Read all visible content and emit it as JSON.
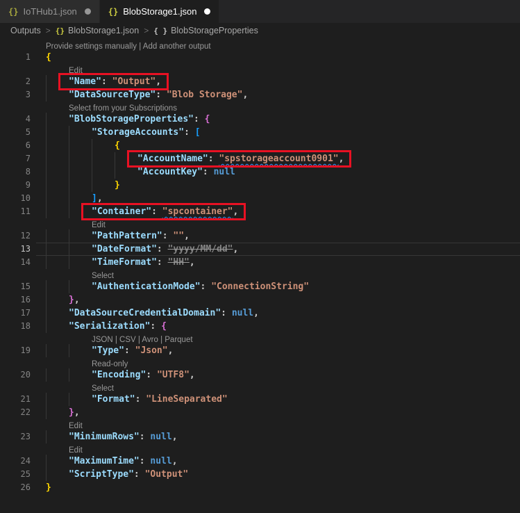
{
  "tabs": [
    {
      "icon": "{}",
      "label": "IoTHub1.json",
      "modified": true,
      "active": false
    },
    {
      "icon": "{}",
      "label": "BlobStorage1.json",
      "modified": true,
      "active": true
    }
  ],
  "breadcrumb": {
    "separator": ">",
    "items": [
      {
        "label": "Outputs"
      },
      {
        "icon": "{}",
        "label": "BlobStorage1.json"
      },
      {
        "icon": "{ }",
        "label": "BlobStorageProperties"
      }
    ]
  },
  "colors": {
    "editor_background": "#1e1e1e",
    "tabbar_background": "#252526",
    "red_highlight_box": "#e81123",
    "info_squiggle": "#3794ff",
    "key": "#9cdcfe",
    "string": "#ce9178",
    "keyword_null": "#569cd6",
    "bracket_level1": "#ffd700",
    "bracket_level2": "#da70d6",
    "bracket_level3": "#179fff"
  },
  "editor": {
    "language": "json",
    "current_line": 13,
    "lines": [
      {
        "num": 1,
        "indent": 0,
        "lens": {
          "text": "Provide settings manually | Add another output",
          "indent": 0
        },
        "tokens": [
          [
            "b1",
            "{"
          ]
        ]
      },
      {
        "num": 2,
        "indent": 1,
        "lens": {
          "text": "Edit",
          "indent": 1
        },
        "redbox": true,
        "tokens": [
          [
            "k",
            "\"Name\""
          ],
          [
            "p",
            ": "
          ],
          [
            "s",
            "\"Output\""
          ],
          [
            "p",
            ","
          ]
        ]
      },
      {
        "num": 3,
        "indent": 1,
        "tokens": [
          [
            "k",
            "\"DataSourceType\""
          ],
          [
            "p",
            ": "
          ],
          [
            "s",
            "\"Blob Storage\""
          ],
          [
            "p",
            ","
          ]
        ]
      },
      {
        "num": 4,
        "indent": 1,
        "lens": {
          "text": "Select from your Subscriptions",
          "indent": 1
        },
        "tokens": [
          [
            "k",
            "\"BlobStorageProperties\""
          ],
          [
            "p",
            ": "
          ],
          [
            "b2",
            "{"
          ]
        ]
      },
      {
        "num": 5,
        "indent": 2,
        "tokens": [
          [
            "k",
            "\"StorageAccounts\""
          ],
          [
            "p",
            ": "
          ],
          [
            "b3",
            "["
          ]
        ]
      },
      {
        "num": 6,
        "indent": 3,
        "tokens": [
          [
            "b1",
            "{"
          ]
        ]
      },
      {
        "num": 7,
        "indent": 4,
        "redbox": true,
        "tokens": [
          [
            "k",
            "\"AccountName\""
          ],
          [
            "p",
            ": "
          ],
          [
            "su",
            "\"spstorageaccount0901\""
          ],
          [
            "p",
            ","
          ]
        ]
      },
      {
        "num": 8,
        "indent": 4,
        "tokens": [
          [
            "k",
            "\"AccountKey\""
          ],
          [
            "p",
            ": "
          ],
          [
            "n",
            "null"
          ]
        ]
      },
      {
        "num": 9,
        "indent": 3,
        "tokens": [
          [
            "b1",
            "}"
          ]
        ]
      },
      {
        "num": 10,
        "indent": 2,
        "tokens": [
          [
            "b3",
            "]"
          ],
          [
            "p",
            ","
          ]
        ]
      },
      {
        "num": 11,
        "indent": 2,
        "redbox": true,
        "tokens": [
          [
            "k",
            "\"Container\""
          ],
          [
            "p",
            ": "
          ],
          [
            "su",
            "\"spcontainer\""
          ],
          [
            "p",
            ","
          ]
        ]
      },
      {
        "num": 12,
        "indent": 2,
        "lens": {
          "text": "Edit",
          "indent": 2
        },
        "tokens": [
          [
            "k",
            "\"PathPattern\""
          ],
          [
            "p",
            ": "
          ],
          [
            "s",
            "\"\""
          ],
          [
            "p",
            ","
          ]
        ]
      },
      {
        "num": 13,
        "indent": 2,
        "current": true,
        "tokens": [
          [
            "k",
            "\"DateFormat\""
          ],
          [
            "p",
            ": "
          ],
          [
            "sx",
            "\"yyyy/MM/dd\""
          ],
          [
            "p",
            ","
          ]
        ]
      },
      {
        "num": 14,
        "indent": 2,
        "tokens": [
          [
            "k",
            "\"TimeFormat\""
          ],
          [
            "p",
            ": "
          ],
          [
            "sx",
            "\"HH\""
          ],
          [
            "p",
            ","
          ]
        ]
      },
      {
        "num": 15,
        "indent": 2,
        "lens": {
          "text": "Select",
          "indent": 2
        },
        "tokens": [
          [
            "k",
            "\"AuthenticationMode\""
          ],
          [
            "p",
            ": "
          ],
          [
            "s",
            "\"ConnectionString\""
          ]
        ]
      },
      {
        "num": 16,
        "indent": 1,
        "tokens": [
          [
            "b2",
            "}"
          ],
          [
            "p",
            ","
          ]
        ]
      },
      {
        "num": 17,
        "indent": 1,
        "tokens": [
          [
            "k",
            "\"DataSourceCredentialDomain\""
          ],
          [
            "p",
            ": "
          ],
          [
            "n",
            "null"
          ],
          [
            "p",
            ","
          ]
        ]
      },
      {
        "num": 18,
        "indent": 1,
        "tokens": [
          [
            "k",
            "\"Serialization\""
          ],
          [
            "p",
            ": "
          ],
          [
            "b2",
            "{"
          ]
        ]
      },
      {
        "num": 19,
        "indent": 2,
        "lens": {
          "text": "JSON | CSV | Avro | Parquet",
          "indent": 2
        },
        "tokens": [
          [
            "k",
            "\"Type\""
          ],
          [
            "p",
            ": "
          ],
          [
            "s",
            "\"Json\""
          ],
          [
            "p",
            ","
          ]
        ]
      },
      {
        "num": 20,
        "indent": 2,
        "lens": {
          "text": "Read-only",
          "indent": 2
        },
        "tokens": [
          [
            "k",
            "\"Encoding\""
          ],
          [
            "p",
            ": "
          ],
          [
            "s",
            "\"UTF8\""
          ],
          [
            "p",
            ","
          ]
        ]
      },
      {
        "num": 21,
        "indent": 2,
        "lens": {
          "text": "Select",
          "indent": 2
        },
        "tokens": [
          [
            "k",
            "\"Format\""
          ],
          [
            "p",
            ": "
          ],
          [
            "s",
            "\"LineSeparated\""
          ]
        ]
      },
      {
        "num": 22,
        "indent": 1,
        "tokens": [
          [
            "b2",
            "}"
          ],
          [
            "p",
            ","
          ]
        ]
      },
      {
        "num": 23,
        "indent": 1,
        "lens": {
          "text": "Edit",
          "indent": 1
        },
        "tokens": [
          [
            "k",
            "\"MinimumRows\""
          ],
          [
            "p",
            ": "
          ],
          [
            "n",
            "null"
          ],
          [
            "p",
            ","
          ]
        ]
      },
      {
        "num": 24,
        "indent": 1,
        "lens": {
          "text": "Edit",
          "indent": 1
        },
        "tokens": [
          [
            "k",
            "\"MaximumTime\""
          ],
          [
            "p",
            ": "
          ],
          [
            "n",
            "null"
          ],
          [
            "p",
            ","
          ]
        ]
      },
      {
        "num": 25,
        "indent": 1,
        "tokens": [
          [
            "k",
            "\"ScriptType\""
          ],
          [
            "p",
            ": "
          ],
          [
            "s",
            "\"Output\""
          ]
        ]
      },
      {
        "num": 26,
        "indent": 0,
        "tokens": [
          [
            "b1",
            "}"
          ]
        ]
      }
    ]
  }
}
